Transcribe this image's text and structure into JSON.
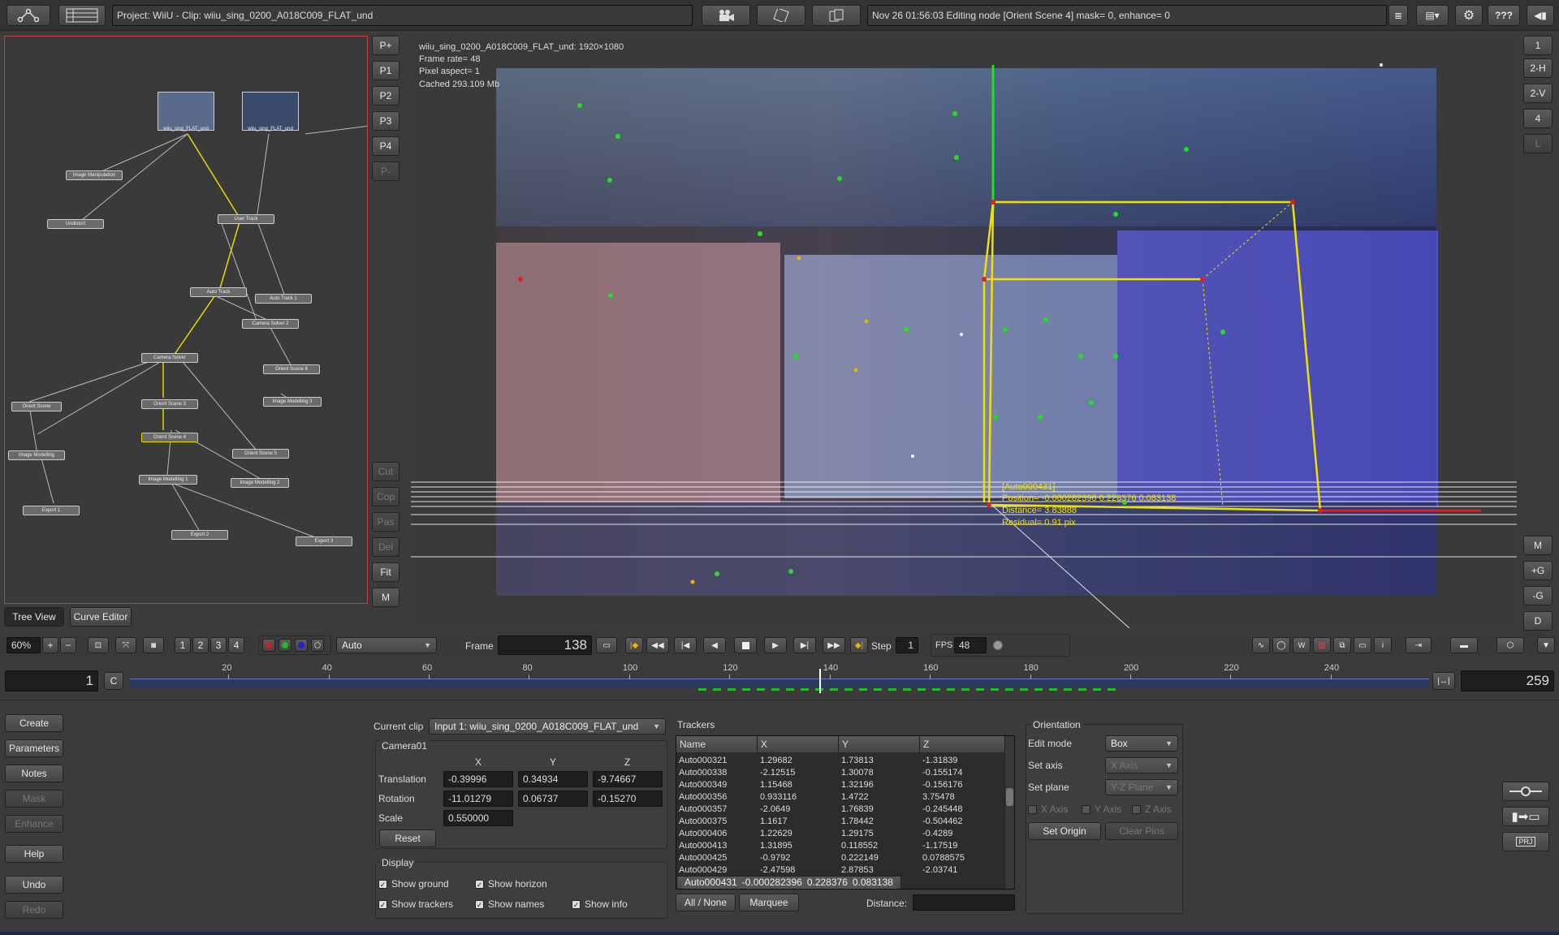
{
  "topbar": {
    "project": "Project: WiiU - Clip: wiiu_sing_0200_A018C009_FLAT_und",
    "status": "Nov 26 01:56:03 Editing node [Orient Scene 4] mask= 0, enhance= 0",
    "help_label": "???"
  },
  "tree": {
    "nodes": [
      {
        "label": "wiiu_sing_FLAT_und"
      },
      {
        "label": "wiiu_sing_FLAT_und"
      },
      {
        "label": "Image Manipulation"
      },
      {
        "label": "Undistort"
      },
      {
        "label": "User Track"
      },
      {
        "label": "Auto Track"
      },
      {
        "label": "Auto Track 1"
      },
      {
        "label": "Camera Solver 2"
      },
      {
        "label": "Camera Solver"
      },
      {
        "label": "Orient Scene 6"
      },
      {
        "label": "Orient Scene"
      },
      {
        "label": "Orient Scene 3"
      },
      {
        "label": "Image Modelling 3"
      },
      {
        "label": "Orient Scene 4"
      },
      {
        "label": "Orient Scene 5"
      },
      {
        "label": "Image Modelling"
      },
      {
        "label": "Image Modelling 1"
      },
      {
        "label": "Image Modelling 2"
      },
      {
        "label": "Export 1"
      },
      {
        "label": "Export 2"
      },
      {
        "label": "Export 3"
      }
    ],
    "tab_tree": "Tree View",
    "tab_curve": "Curve Editor"
  },
  "side_buttons": [
    "P+",
    "P1",
    "P2",
    "P3",
    "P4",
    "P-",
    "Cut",
    "Cop",
    "Pas",
    "Del",
    "Fit",
    "M"
  ],
  "right_buttons": [
    "1",
    "2-H",
    "2-V",
    "4",
    "L",
    "M",
    "+G",
    "-G",
    "D"
  ],
  "viewer": {
    "info1": "wiiu_sing_0200_A018C009_FLAT_und: 1920×1080",
    "info2": "Frame rate= 48",
    "info3": "Pixel aspect= 1",
    "info4": "Cached 293.109 Mb",
    "tip1": "[Auto000431]",
    "tip2": "Position= -0.000282396 0.228376 0.083138",
    "tip3": "Distance= 3.83888",
    "tip4": "Residual= 0.91 pix"
  },
  "controls": {
    "zoom": "60%",
    "view_nums": [
      "1",
      "2",
      "3",
      "4"
    ],
    "mode": "Auto",
    "frame_label": "Frame",
    "frame": "138",
    "step_label": "Step",
    "step": "1",
    "fps_label": "FPS",
    "fps": "48"
  },
  "timeline": {
    "start": "1",
    "c_label": "C",
    "end": "259",
    "ticks": [
      "20",
      "40",
      "60",
      "80",
      "100",
      "120",
      "140",
      "160",
      "180",
      "200",
      "220",
      "240"
    ],
    "range": [
      1,
      259
    ],
    "current": 138
  },
  "left_menu": [
    "Create",
    "Parameters",
    "Notes",
    "Mask",
    "Enhance",
    "Help",
    "Undo",
    "Redo"
  ],
  "params": {
    "current_clip_label": "Current clip",
    "current_clip": "Input 1: wiiu_sing_0200_A018C009_FLAT_und",
    "camera_title": "Camera01",
    "col_x": "X",
    "col_y": "Y",
    "col_z": "Z",
    "translation_label": "Translation",
    "translation": [
      "-0.39996",
      "0.34934",
      "-9.74667"
    ],
    "rotation_label": "Rotation",
    "rotation": [
      "-11.01279",
      "0.06737",
      "-0.15270"
    ],
    "scale_label": "Scale",
    "scale": "0.550000",
    "reset": "Reset",
    "display_title": "Display",
    "show_ground": "Show ground",
    "show_horizon": "Show horizon",
    "show_trackers": "Show trackers",
    "show_names": "Show names",
    "show_info": "Show info"
  },
  "trackers": {
    "title": "Trackers",
    "headers": [
      "Name",
      "X",
      "Y",
      "Z"
    ],
    "rows": [
      [
        "Auto000321",
        "1.29682",
        "1.73813",
        "-1.31839"
      ],
      [
        "Auto000338",
        "-2.12515",
        "1.30078",
        "-0.155174"
      ],
      [
        "Auto000349",
        "1.15468",
        "1.32196",
        "-0.156176"
      ],
      [
        "Auto000356",
        "0.933116",
        "1.4722",
        "3.75478"
      ],
      [
        "Auto000357",
        "-2.0649",
        "1.76839",
        "-0.245448"
      ],
      [
        "Auto000375",
        "1.1617",
        "1.78442",
        "-0.504462"
      ],
      [
        "Auto000406",
        "1.22629",
        "1.29175",
        "-0.4289"
      ],
      [
        "Auto000413",
        "1.31895",
        "0.118552",
        "-1.17519"
      ],
      [
        "Auto000425",
        "-0.9792",
        "0.222149",
        "0.0788575"
      ],
      [
        "Auto000429",
        "-2.47598",
        "2.87853",
        "-2.03741"
      ],
      [
        "Auto000431",
        "-0.000282396",
        "0.228376",
        "0.083138"
      ]
    ],
    "all_none": "All / None",
    "marquee": "Marquee",
    "distance_label": "Distance:"
  },
  "orientation": {
    "title": "Orientation",
    "edit_mode_label": "Edit mode",
    "edit_mode": "Box",
    "set_axis_label": "Set axis",
    "set_axis": "X Axis",
    "set_plane_label": "Set plane",
    "set_plane": "Y-Z Plane",
    "x_axis": "X Axis",
    "y_axis": "Y Axis",
    "z_axis": "Z Axis",
    "set_origin": "Set Origin",
    "clear_pins": "Clear Pins"
  },
  "right_tools": {
    "prj": "PRJ"
  }
}
